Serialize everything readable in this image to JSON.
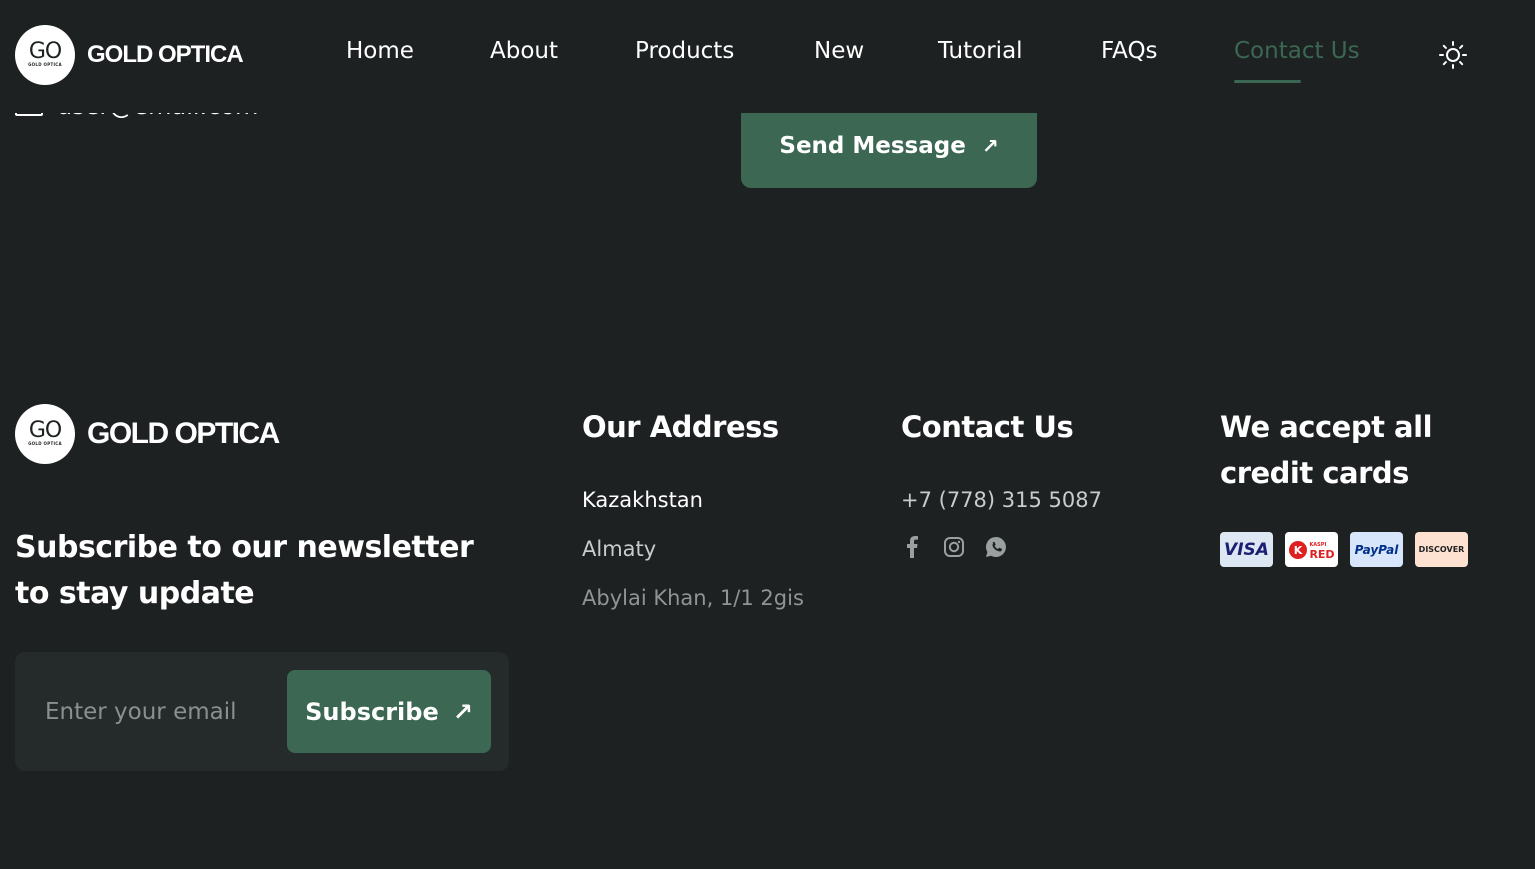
{
  "brand": {
    "logo_mark": "GO",
    "logo_sub": "GOLD OPTICA",
    "name": "GOLD OPTICA"
  },
  "nav": {
    "items": [
      {
        "label": "Home"
      },
      {
        "label": "About"
      },
      {
        "label": "Products"
      },
      {
        "label": "New"
      },
      {
        "label": "Tutorial"
      },
      {
        "label": "FAQs"
      },
      {
        "label": "Contact Us",
        "active": true
      }
    ],
    "theme_icon": "sun-icon"
  },
  "contact_form": {
    "email_text": "user@email.com",
    "send_label": "Send Message"
  },
  "footer": {
    "newsletter_heading": "Subscribe to our newsletter to stay update",
    "email_placeholder": "Enter your email",
    "subscribe_label": "Subscribe",
    "address": {
      "heading": "Our Address",
      "country": "Kazakhstan",
      "city": "Almaty",
      "street": "Abylai Khan, 1/1 2gis"
    },
    "contact": {
      "heading": "Contact Us",
      "phone": "+7 (778) 315 5087",
      "social": [
        "facebook-icon",
        "instagram-icon",
        "whatsapp-icon"
      ]
    },
    "cards": {
      "heading": "We accept all credit cards",
      "items": [
        {
          "name": "visa",
          "label": "VISA"
        },
        {
          "name": "kaspi",
          "label": "RED",
          "sub": "KASPI"
        },
        {
          "name": "paypal",
          "label": "PayPal"
        },
        {
          "name": "discover",
          "label": "DISCOVER"
        }
      ]
    }
  },
  "colors": {
    "background": "#1d2122",
    "accent": "#3c6753",
    "panel": "#252a2b"
  }
}
